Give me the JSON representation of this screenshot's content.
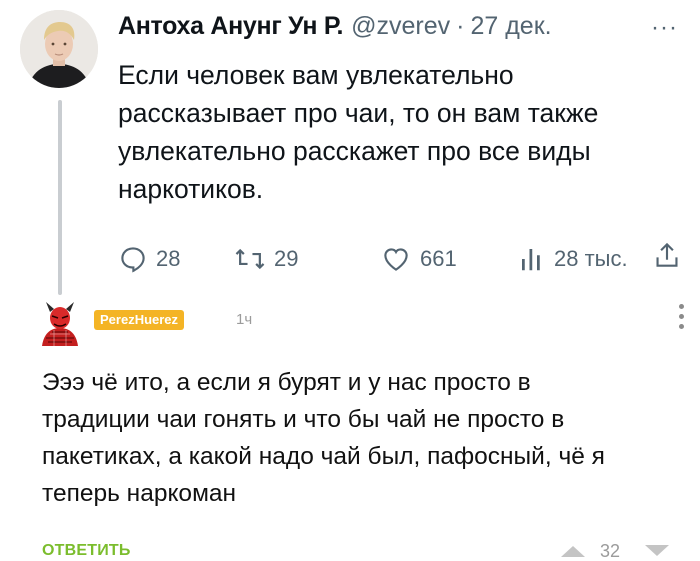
{
  "tweet": {
    "author_name": "Антоха Анунг Ун Р.",
    "handle": "@zverev",
    "separator": "·",
    "date": "27 дек.",
    "more": "···",
    "text": "Если человек вам увлекательно\nрассказывает про чаи, то он вам также\nувлекательно расскажет про все виды\nнаркотиков.",
    "stats": {
      "replies": "28",
      "retweets": "29",
      "likes": "661",
      "views": "28 тыс."
    }
  },
  "comment": {
    "username": "PerezHuerez",
    "time": "1ч",
    "text": "Эээ чё ито, а если я бурят и у нас просто в\nтрадиции чаи гонять и что бы чай не просто в\nпакетиках, а какой надо чай был, пафосный, чё я\nтеперь наркоман",
    "reply_label": "ОТВЕТИТЬ",
    "score": "32"
  },
  "colors": {
    "tweet_text": "#0f1419",
    "tweet_muted": "#536471",
    "username_badge": "#f4b425",
    "reply_green": "#7bbd2d",
    "comment_muted": "#9b9b9b"
  }
}
